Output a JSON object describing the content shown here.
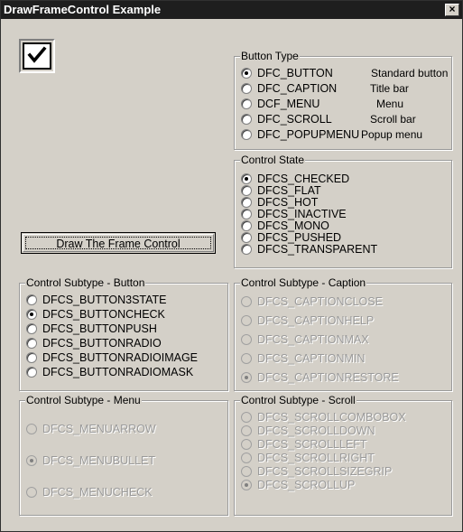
{
  "window": {
    "title": "DrawFrameControl Example",
    "close_label": "×"
  },
  "preview": {
    "icon": "checkmark-icon"
  },
  "draw_button": {
    "label": "Draw The Frame Control"
  },
  "button_type": {
    "title": "Button Type",
    "selected": 0,
    "options": [
      {
        "label": "DFC_BUTTON",
        "description": "Standard button"
      },
      {
        "label": "DFC_CAPTION",
        "description": "Title bar"
      },
      {
        "label": "DCF_MENU",
        "description": "Menu"
      },
      {
        "label": "DFC_SCROLL",
        "description": "Scroll bar"
      },
      {
        "label": "DFC_POPUPMENU",
        "description": "Popup menu"
      }
    ]
  },
  "control_state": {
    "title": "Control State",
    "selected": 0,
    "options": [
      "DFCS_CHECKED",
      "DFCS_FLAT",
      "DFCS_HOT",
      "DFCS_INACTIVE",
      "DFCS_MONO",
      "DFCS_PUSHED",
      "DFCS_TRANSPARENT"
    ]
  },
  "subtype_button": {
    "title": "Control Subtype - Button",
    "enabled": true,
    "selected": 1,
    "options": [
      "DFCS_BUTTON3STATE",
      "DFCS_BUTTONCHECK",
      "DFCS_BUTTONPUSH",
      "DFCS_BUTTONRADIO",
      "DFCS_BUTTONRADIOIMAGE",
      "DFCS_BUTTONRADIOMASK"
    ]
  },
  "subtype_caption": {
    "title": "Control Subtype - Caption",
    "enabled": false,
    "selected": 4,
    "options": [
      "DFCS_CAPTIONCLOSE",
      "DFCS_CAPTIONHELP",
      "DFCS_CAPTIONMAX",
      "DFCS_CAPTIONMIN",
      "DFCS_CAPTIONRESTORE"
    ]
  },
  "subtype_menu": {
    "title": "Control Subtype - Menu",
    "enabled": false,
    "selected": 1,
    "options": [
      "DFCS_MENUARROW",
      "DFCS_MENUBULLET",
      "DFCS_MENUCHECK"
    ]
  },
  "subtype_scroll": {
    "title": "Control Subtype - Scroll",
    "enabled": false,
    "selected": 5,
    "options": [
      "DFCS_SCROLLCOMBOBOX",
      "DFCS_SCROLLDOWN",
      "DFCS_SCROLLLEFT",
      "DFCS_SCROLLRIGHT",
      "DFCS_SCROLLSIZEGRIP",
      "DFCS_SCROLLUP"
    ]
  }
}
